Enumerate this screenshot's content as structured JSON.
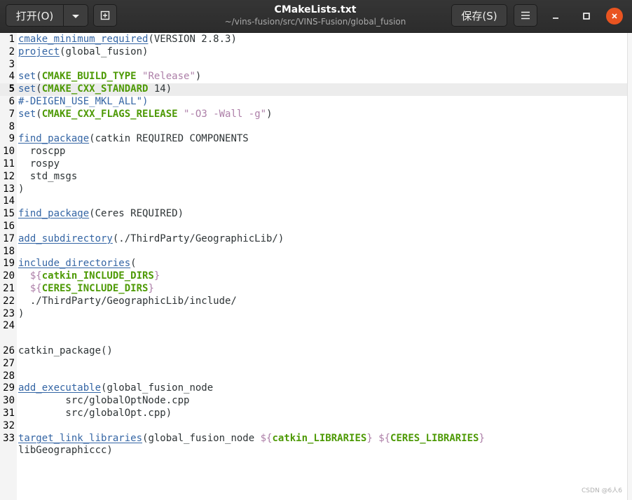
{
  "header": {
    "open_label": "打开(O)",
    "open_menu_icon": "chevron-down-icon",
    "new_tab_icon": "new-tab-icon",
    "title": "CMakeLists.txt",
    "subtitle": "~/vins-fusion/src/VINS-Fusion/global_fusion",
    "save_label": "保存(S)",
    "menu_icon": "hamburger-icon",
    "window_controls": [
      "minimize-icon",
      "maximize-icon",
      "close-icon"
    ]
  },
  "editor": {
    "current_line": 5,
    "lines": [
      {
        "n": "1",
        "segs": [
          [
            "kw",
            "cmake_minimum_required"
          ],
          [
            "plain",
            "(VERSION 2.8.3)"
          ]
        ]
      },
      {
        "n": "2",
        "segs": [
          [
            "kw",
            "project"
          ],
          [
            "plain",
            "(global_fusion)"
          ]
        ]
      },
      {
        "n": "3",
        "segs": []
      },
      {
        "n": "4",
        "segs": [
          [
            "cmd",
            "set"
          ],
          [
            "plain",
            "("
          ],
          [
            "var",
            "CMAKE_BUILD_TYPE"
          ],
          [
            "plain",
            " "
          ],
          [
            "str",
            "\"Release\""
          ],
          [
            "plain",
            ")"
          ]
        ]
      },
      {
        "n": "5",
        "segs": [
          [
            "cmd",
            "set"
          ],
          [
            "plain",
            "("
          ],
          [
            "var",
            "CMAKE_CXX_STANDARD"
          ],
          [
            "plain",
            " 14)"
          ]
        ]
      },
      {
        "n": "6",
        "segs": [
          [
            "cmt",
            "#-DEIGEN_USE_MKL_ALL\")"
          ]
        ]
      },
      {
        "n": "7",
        "segs": [
          [
            "cmd",
            "set"
          ],
          [
            "plain",
            "("
          ],
          [
            "var",
            "CMAKE_CXX_FLAGS_RELEASE"
          ],
          [
            "plain",
            " "
          ],
          [
            "str",
            "\"-O3 -Wall -g\""
          ],
          [
            "plain",
            ")"
          ]
        ]
      },
      {
        "n": "8",
        "segs": []
      },
      {
        "n": "9",
        "segs": [
          [
            "kw",
            "find_package"
          ],
          [
            "plain",
            "(catkin REQUIRED COMPONENTS"
          ]
        ]
      },
      {
        "n": "10",
        "segs": [
          [
            "plain",
            "  roscpp"
          ]
        ]
      },
      {
        "n": "11",
        "segs": [
          [
            "plain",
            "  rospy"
          ]
        ]
      },
      {
        "n": "12",
        "segs": [
          [
            "plain",
            "  std_msgs"
          ]
        ]
      },
      {
        "n": "13",
        "segs": [
          [
            "plain",
            ")"
          ]
        ]
      },
      {
        "n": "14",
        "segs": []
      },
      {
        "n": "15",
        "segs": [
          [
            "kw",
            "find_package"
          ],
          [
            "plain",
            "(Ceres REQUIRED)"
          ]
        ]
      },
      {
        "n": "16",
        "segs": []
      },
      {
        "n": "17",
        "segs": [
          [
            "kw",
            "add_subdirectory"
          ],
          [
            "plain",
            "(./ThirdParty/GeographicLib/)"
          ]
        ]
      },
      {
        "n": "18",
        "segs": []
      },
      {
        "n": "19",
        "segs": [
          [
            "kw",
            "include_directories"
          ],
          [
            "plain",
            "("
          ]
        ]
      },
      {
        "n": "20",
        "segs": [
          [
            "plain",
            "  "
          ],
          [
            "str",
            "${"
          ],
          [
            "var",
            "catkin_INCLUDE_DIRS"
          ],
          [
            "str",
            "}"
          ]
        ]
      },
      {
        "n": "21",
        "segs": [
          [
            "plain",
            "  "
          ],
          [
            "str",
            "${"
          ],
          [
            "var",
            "CERES_INCLUDE_DIRS"
          ],
          [
            "str",
            "}"
          ]
        ]
      },
      {
        "n": "22",
        "segs": [
          [
            "plain",
            "  ./ThirdParty/GeographicLib/include/"
          ]
        ]
      },
      {
        "n": "23",
        "segs": [
          [
            "plain",
            ")"
          ]
        ]
      },
      {
        "n": "24",
        "segs": []
      },
      {
        "n": "",
        "segs": []
      },
      {
        "n": "26",
        "segs": [
          [
            "plain",
            "catkin_package()"
          ]
        ]
      },
      {
        "n": "27",
        "segs": []
      },
      {
        "n": "28",
        "segs": []
      },
      {
        "n": "29",
        "segs": [
          [
            "kw",
            "add_executable"
          ],
          [
            "plain",
            "(global_fusion_node"
          ]
        ]
      },
      {
        "n": "30",
        "segs": [
          [
            "plain",
            "        src/globalOptNode.cpp"
          ]
        ]
      },
      {
        "n": "31",
        "segs": [
          [
            "plain",
            "        src/globalOpt.cpp)"
          ]
        ]
      },
      {
        "n": "32",
        "segs": []
      },
      {
        "n": "33",
        "segs": [
          [
            "kw",
            "target_link_libraries"
          ],
          [
            "plain",
            "(global_fusion_node "
          ],
          [
            "str",
            "${"
          ],
          [
            "var",
            "catkin_LIBRARIES"
          ],
          [
            "str",
            "}"
          ],
          [
            "plain",
            " "
          ],
          [
            "str",
            "${"
          ],
          [
            "var",
            "CERES_LIBRARIES"
          ],
          [
            "str",
            "}"
          ]
        ]
      },
      {
        "n": "",
        "segs": [
          [
            "plain",
            "libGeographiccc)"
          ]
        ]
      }
    ]
  },
  "watermark": "CSDN @6人6"
}
